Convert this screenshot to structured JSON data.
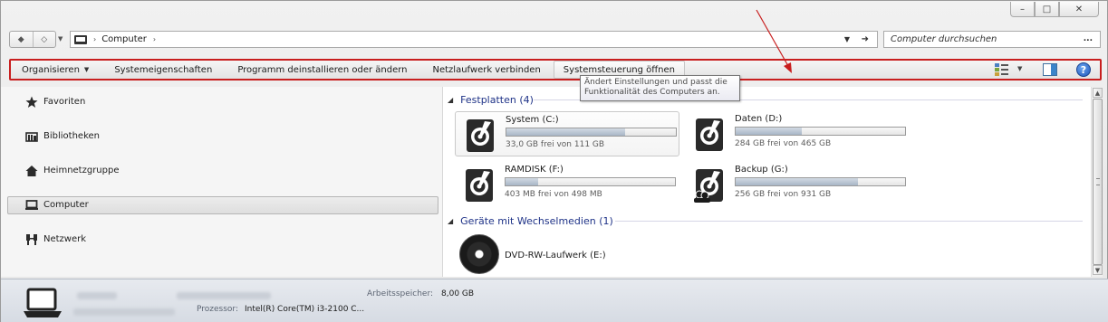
{
  "window": {
    "caption_buttons": [
      "–",
      "□",
      "✕"
    ]
  },
  "address": {
    "location": "Computer",
    "search_placeholder": "Computer durchsuchen"
  },
  "toolbar": {
    "items": [
      {
        "label": "Organisieren",
        "dropdown": true
      },
      {
        "label": "Systemeigenschaften"
      },
      {
        "label": "Programm deinstallieren oder ändern"
      },
      {
        "label": "Netzlaufwerk verbinden"
      },
      {
        "label": "Systemsteuerung öffnen"
      }
    ],
    "tooltip": "Ändert Einstellungen und passt die Funktionalität des Computers an.",
    "help": "?"
  },
  "nav": {
    "items": [
      {
        "label": "Favoriten",
        "icon": "star-icon"
      },
      {
        "label": "Bibliotheken",
        "icon": "library-icon"
      },
      {
        "label": "Heimnetzgruppe",
        "icon": "homegroup-icon"
      },
      {
        "label": "Computer",
        "icon": "computer-icon",
        "selected": true
      },
      {
        "label": "Netzwerk",
        "icon": "network-icon"
      }
    ]
  },
  "content": {
    "groups": [
      {
        "title": "Festplatten (4)"
      },
      {
        "title": "Geräte mit Wechselmedien (1)"
      }
    ],
    "drives": [
      {
        "name": "System (C:)",
        "free": "33,0 GB frei von 111 GB",
        "used_fraction": 0.7,
        "selected": true
      },
      {
        "name": "Daten (D:)",
        "free": "284 GB frei von 465 GB",
        "used_fraction": 0.39
      },
      {
        "name": "RAMDISK (F:)",
        "free": "403 MB frei von 498 MB",
        "used_fraction": 0.19
      },
      {
        "name": "Backup (G:)",
        "free": "256 GB frei von 931 GB",
        "used_fraction": 0.72
      }
    ],
    "removable": [
      {
        "name": "DVD-RW-Laufwerk (E:)",
        "icon": "dvd-icon"
      }
    ]
  },
  "details": {
    "memory_label": "Arbeitsspeicher:",
    "memory_value": "8,00 GB",
    "cpu_label": "Prozessor:",
    "cpu_value": "Intel(R) Core(TM) i3-2100 C..."
  },
  "colors": {
    "highlight_box": "#c81e1e",
    "group_header": "#1e3287"
  }
}
